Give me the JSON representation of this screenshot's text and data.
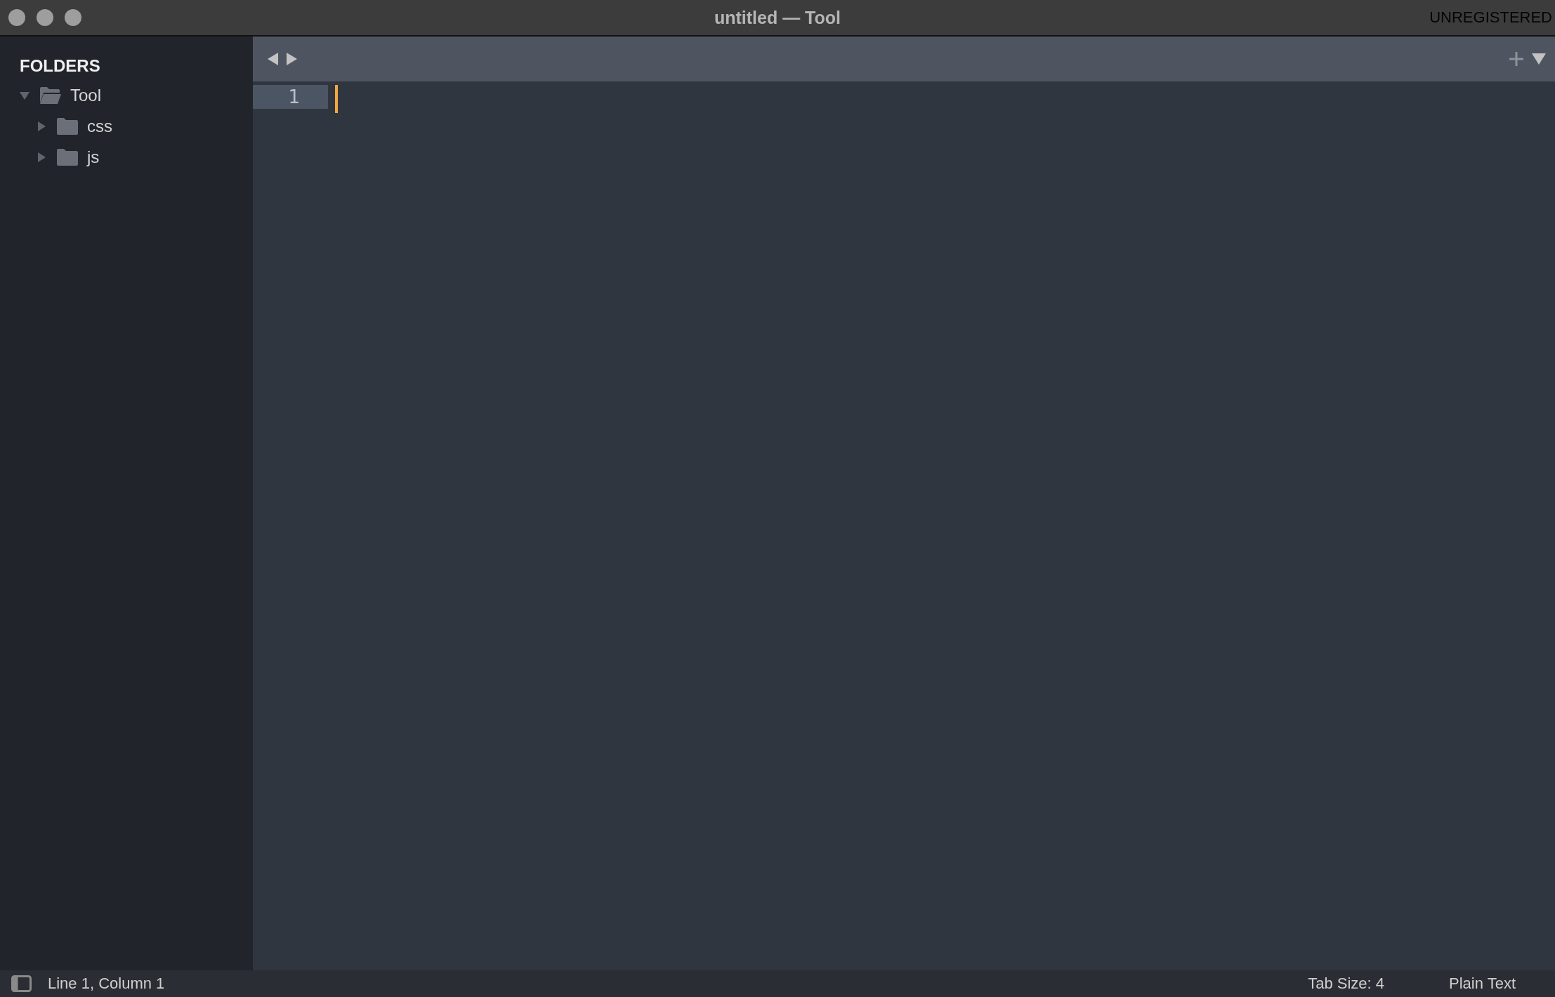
{
  "window": {
    "title": "untitled — Tool",
    "badge": "UNREGISTERED"
  },
  "sidebar": {
    "heading": "FOLDERS",
    "tree": [
      {
        "label": "Tool",
        "expanded": true,
        "children": [
          {
            "label": "css",
            "expanded": false
          },
          {
            "label": "js",
            "expanded": false
          }
        ]
      }
    ]
  },
  "editor": {
    "lines": [
      "1"
    ]
  },
  "status_bar": {
    "position": "Line 1, Column 1",
    "tab_size": "Tab Size: 4",
    "syntax": "Plain Text"
  }
}
